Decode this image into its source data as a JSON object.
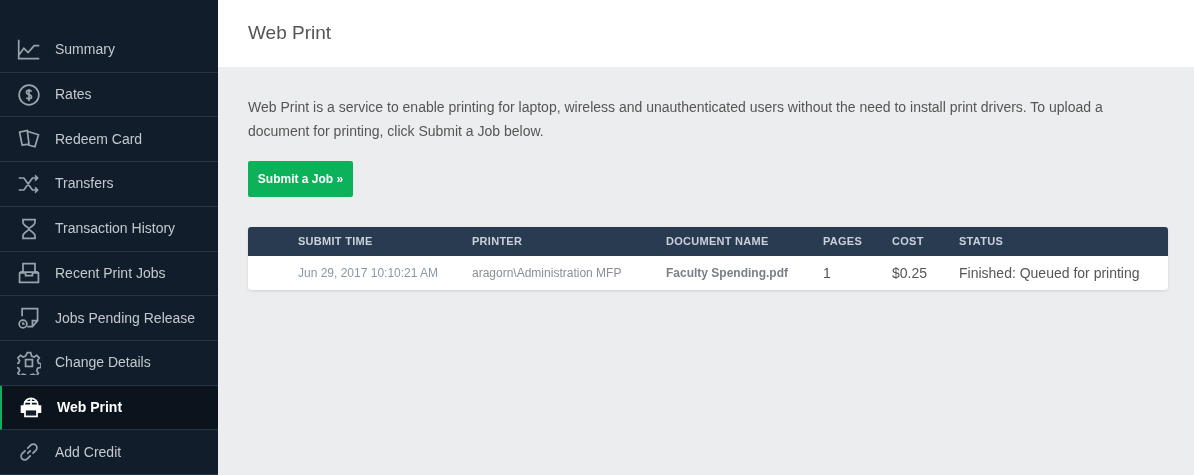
{
  "sidebar": {
    "items": [
      {
        "label": "Summary",
        "selected": false
      },
      {
        "label": "Rates",
        "selected": false
      },
      {
        "label": "Redeem Card",
        "selected": false
      },
      {
        "label": "Transfers",
        "selected": false
      },
      {
        "label": "Transaction History",
        "selected": false
      },
      {
        "label": "Recent Print Jobs",
        "selected": false
      },
      {
        "label": "Jobs Pending Release",
        "selected": false
      },
      {
        "label": "Change Details",
        "selected": false
      },
      {
        "label": "Web Print",
        "selected": true
      },
      {
        "label": "Add Credit",
        "selected": false
      }
    ]
  },
  "page_title": "Web Print",
  "intro": "Web Print is a service to enable printing for laptop, wireless and unauthenticated users without the need to install print drivers. To upload a document for printing, click Submit a Job below.",
  "submit_button": "Submit a Job »",
  "table": {
    "columns": [
      "SUBMIT TIME",
      "PRINTER",
      "DOCUMENT NAME",
      "PAGES",
      "COST",
      "STATUS"
    ],
    "rows": [
      [
        "Jun 29, 2017 10:10:21 AM",
        "aragorn\\Administration MFP",
        "Faculty Spending.pdf",
        "1",
        "$0.25",
        "Finished: Queued for printing"
      ]
    ]
  }
}
